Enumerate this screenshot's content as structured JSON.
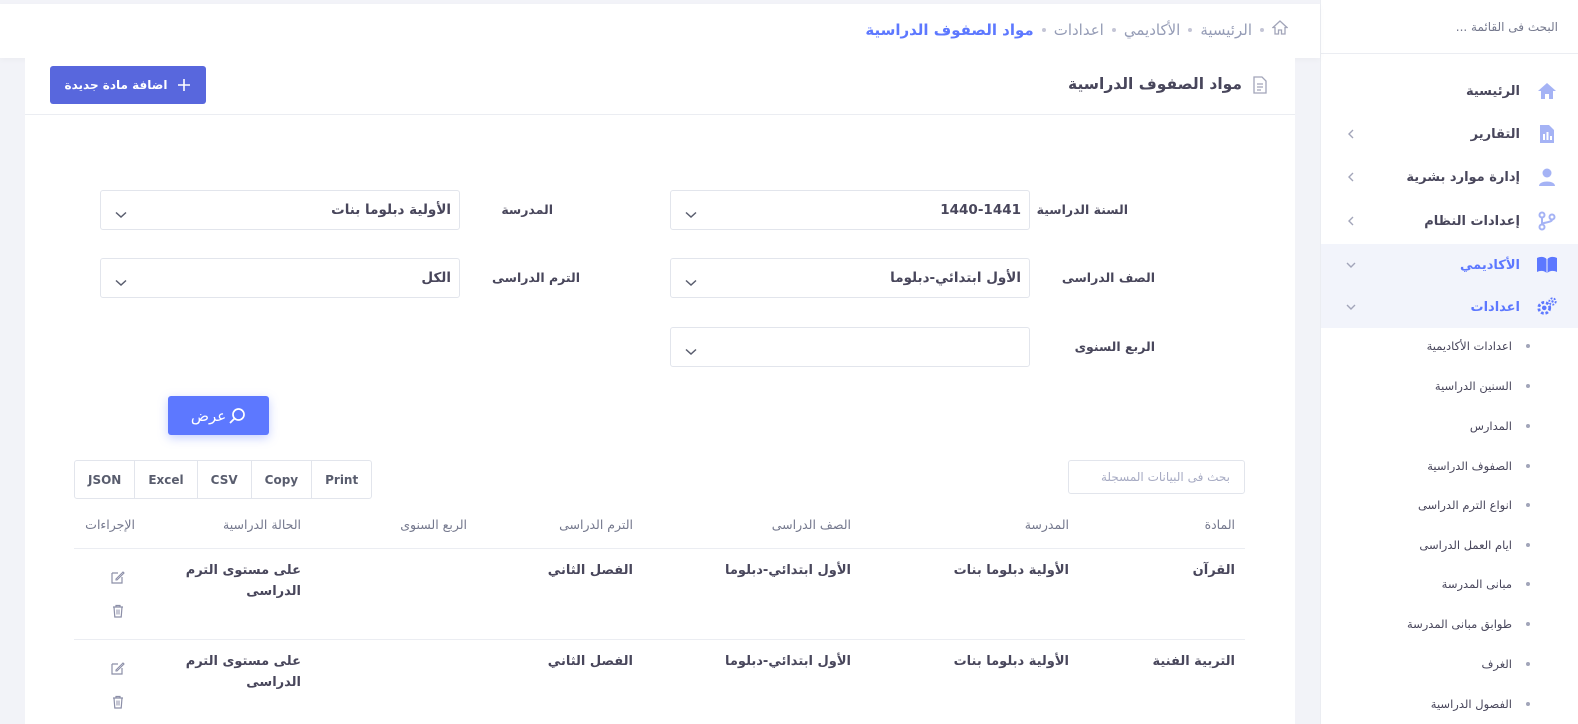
{
  "sidebar": {
    "search_placeholder": "البحث فى القائمة ...",
    "items": [
      {
        "label": "الرئيسية",
        "icon": "home-icon"
      },
      {
        "label": "التقارير",
        "icon": "report-icon"
      },
      {
        "label": "إدارة موارد بشرية",
        "icon": "user-icon"
      },
      {
        "label": "إعدادات النظام",
        "icon": "git-branch-icon"
      },
      {
        "label": "الأكاديمي",
        "icon": "book-icon"
      },
      {
        "label": "اعدادات",
        "icon": "gears-icon"
      }
    ],
    "sub_items": [
      "اعدادات الأكاديمية",
      "السنين الدراسية",
      "المدارس",
      "الصفوف الدراسية",
      "انواع الترم الدراسى",
      "ايام العمل الدراسى",
      "مبانى المدرسة",
      "طوابق مبانى المدرسة",
      "الغرف",
      "الفصول الدراسية"
    ]
  },
  "breadcrumb": [
    "الرئيسية",
    "الأكاديمي",
    "اعدادات",
    "مواد الصفوف الدراسية"
  ],
  "page": {
    "title": "مواد الصفوف الدراسية",
    "add_button": "اضافة مادة جديدة",
    "show_button": "عرض"
  },
  "filters": {
    "year_label": "السنة الدراسية",
    "year_value": "1440-1441",
    "school_label": "المدرسة",
    "school_value": "الأولية دبلوما بنات",
    "grade_label": "الصف الدراسى",
    "grade_value": "الأول ابتدائي-دبلوما",
    "term_label": "الترم الدراسى",
    "term_value": "الكل",
    "quarter_label": "الربع السنوى",
    "quarter_value": ""
  },
  "export": [
    "Print",
    "Copy",
    "CSV",
    "Excel",
    "JSON"
  ],
  "table": {
    "search_placeholder": "بحث فى البيانات المسجلة",
    "columns": [
      "المادة",
      "المدرسة",
      "الصف الدراسى",
      "الترم الدراسى",
      "الربع السنوى",
      "الحالة الدراسية",
      "الإجراءات"
    ],
    "rows": [
      {
        "subject": "القرآن",
        "school": "الأولية دبلوما بنات",
        "grade": "الأول ابتدائي-دبلوما",
        "term": "الفصل الثاني",
        "quarter": "",
        "status_1": "على مستوى الترم",
        "status_2": "الدراسى"
      },
      {
        "subject": "التربية الفنية",
        "school": "الأولية دبلوما بنات",
        "grade": "الأول ابتدائي-دبلوما",
        "term": "الفصل الثاني",
        "quarter": "",
        "status_1": "على مستوى الترم",
        "status_2": "الدراسى"
      }
    ]
  },
  "colors": {
    "primary": "#5d78ff",
    "add_button": "#5867dd",
    "text_dark": "#48465b",
    "text_muted": "#74788d",
    "active_bg": "#f2f4fb"
  }
}
